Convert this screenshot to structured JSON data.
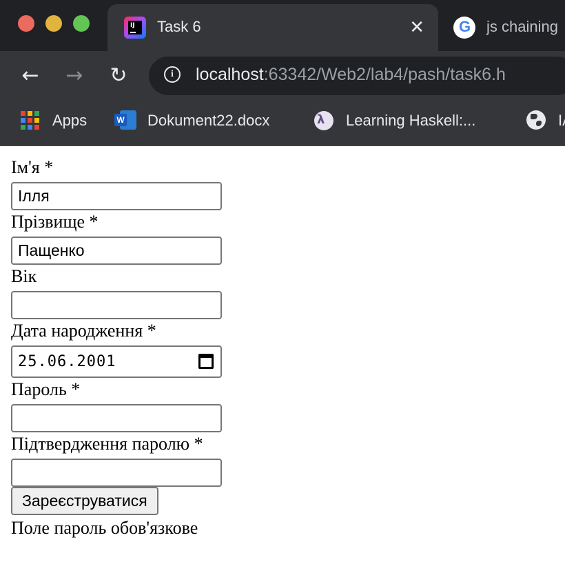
{
  "browser": {
    "active_tab": {
      "title": "Task 6",
      "close_glyph": "✕"
    },
    "inactive_tab": {
      "title": "js chaining"
    },
    "nav": {
      "back": "←",
      "forward": "→",
      "reload": "↻"
    },
    "address": {
      "host": "localhost",
      "path": ":63342/Web2/lab4/pash/task6.h"
    },
    "bookmarks": [
      {
        "label": "Apps",
        "icon": "apps-grid-icon"
      },
      {
        "label": "Dokument22.docx",
        "icon": "word-icon"
      },
      {
        "label": "Learning Haskell:...",
        "icon": "haskell-icon"
      },
      {
        "label": "IA",
        "icon": "globe-icon"
      }
    ],
    "colors": {
      "frame": "#202124",
      "toolbar": "#35363a"
    }
  },
  "form": {
    "first_name": {
      "label": "Ім'я *",
      "value": "Ілля"
    },
    "last_name": {
      "label": "Прізвище *",
      "value": "Пащенко"
    },
    "age": {
      "label": "Вік",
      "value": ""
    },
    "birth_date": {
      "label": "Дата народження *",
      "value": "25.06.2001"
    },
    "password": {
      "label": "Пароль *",
      "value": ""
    },
    "password_confirm": {
      "label": "Підтвердження паролю *",
      "value": ""
    },
    "submit_label": "Зареєструватися",
    "error_message": "Поле пароль обов'язкове"
  }
}
